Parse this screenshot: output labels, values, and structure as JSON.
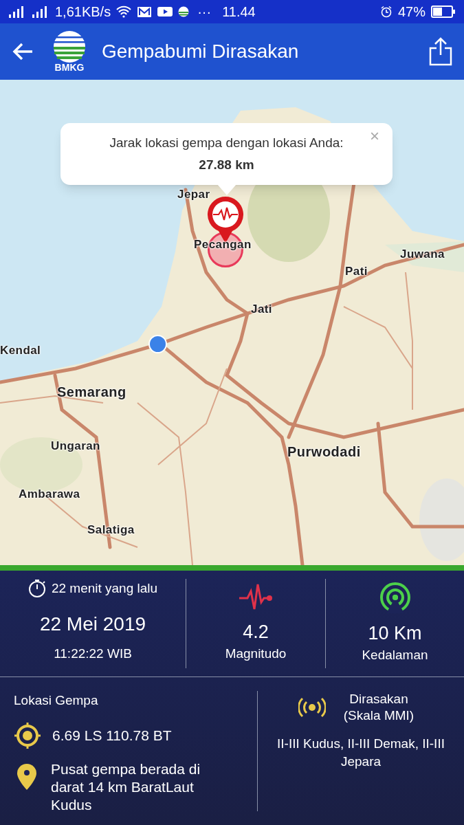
{
  "status_bar": {
    "network_speed": "1,61KB/s",
    "more": "···",
    "time": "11.44",
    "battery": "47%"
  },
  "app_bar": {
    "logo_text": "BMKG",
    "title": "Gempabumi Dirasakan"
  },
  "map": {
    "popup": {
      "label": "Jarak lokasi gempa dengan lokasi Anda:",
      "distance": "27.88 km",
      "close": "×"
    },
    "places": [
      {
        "name": "Jepar"
      },
      {
        "name": "Pecangan"
      },
      {
        "name": "Juwana"
      },
      {
        "name": "Pati"
      },
      {
        "name": "Jati"
      },
      {
        "name": "Kendal"
      },
      {
        "name": "Semarang"
      },
      {
        "name": "Ungaran"
      },
      {
        "name": "Purwodadi"
      },
      {
        "name": "Ambarawa"
      },
      {
        "name": "Salatiga"
      }
    ]
  },
  "summary": {
    "elapsed": "22 menit yang lalu",
    "date": "22 Mei 2019",
    "time": "11:22:22 WIB",
    "magnitude": "4.2",
    "magnitude_label": "Magnitudo",
    "depth": "10 Km",
    "depth_label": "Kedalaman"
  },
  "location": {
    "heading": "Lokasi Gempa",
    "coordinates": "6.69 LS 110.78 BT",
    "description": "Pusat gempa berada di darat 14 km BaratLaut Kudus"
  },
  "felt": {
    "heading": "Dirasakan (Skala MMI)",
    "regions": "II-III Kudus, II-III Demak, II-III Jepara"
  }
}
